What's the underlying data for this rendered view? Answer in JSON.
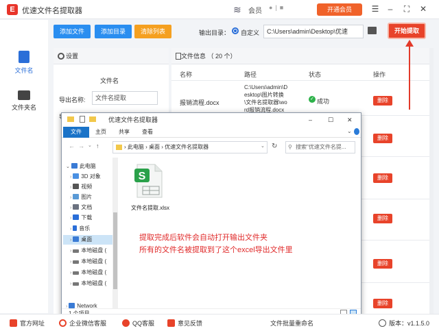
{
  "app": {
    "title": "优速文件名提取器",
    "logo_letter": "E",
    "member_text": "会员",
    "vip_button": "开通会员",
    "brand_icon": "brand-s-logo"
  },
  "sidebar": {
    "items": [
      {
        "label": "文件名",
        "icon": "file-icon",
        "color": "#2a6ed8",
        "active": true
      },
      {
        "label": "文件夹名",
        "icon": "folder-icon",
        "color": "#444444",
        "active": false
      }
    ]
  },
  "toolbar": {
    "add_file": "添加文件",
    "add_dir": "添加目录",
    "clear_list": "清除列表",
    "output_label": "输出目录：",
    "custom_label": "自定义",
    "output_path": "C:\\Users\\admin\\Desktop\\优速",
    "start_button": "开始提取"
  },
  "settings": {
    "header": "设置",
    "section_title": "文件名",
    "export_label": "导出名称:",
    "export_value": "文件名提取",
    "second_label": "导"
  },
  "file_list": {
    "header": "文件信息 （ 20 个）",
    "columns": [
      "名称",
      "路径",
      "状态",
      "操作"
    ],
    "rows": [
      {
        "name": "报销流程.docx",
        "path": "C:\\Users\\admin\\Desktop\\图片转换\\文件名提取器\\wo",
        "status": "成功",
        "action": "删除"
      },
      {
        "name": "",
        "path": "",
        "status": "",
        "action": "删除"
      },
      {
        "name": "",
        "path": "",
        "status": "",
        "action": "删除"
      },
      {
        "name": "",
        "path": "",
        "status": "",
        "action": "删除"
      },
      {
        "name": "",
        "path": "",
        "status": "",
        "action": "删除"
      },
      {
        "name": "",
        "path": "",
        "status": "",
        "action": "删除"
      }
    ],
    "row_path_lines": [
      "C:\\Users\\admin\\D",
      "esktop\\图片转换",
      "\\文件名提取器\\wo",
      "rd报销流程.docx"
    ],
    "status_color": "#2db24a"
  },
  "explorer": {
    "title": "优速文件名提取器",
    "ribbon_tabs": [
      "文件",
      "主页",
      "共享",
      "查看"
    ],
    "address": [
      "此电脑",
      "桌面",
      "优速文件名提取器"
    ],
    "search_placeholder": "搜索\"优速文件名提...",
    "tree": [
      {
        "label": "此电脑",
        "icon": "computer-icon",
        "color": "#3a7bd5"
      },
      {
        "label": "3D 对象",
        "icon": "3d-objects-icon",
        "color": "#4a90e2"
      },
      {
        "label": "视频",
        "icon": "video-icon",
        "color": "#555555"
      },
      {
        "label": "图片",
        "icon": "pictures-icon",
        "color": "#5a9ad6"
      },
      {
        "label": "文档",
        "icon": "documents-icon",
        "color": "#6b7280"
      },
      {
        "label": "下载",
        "icon": "download-icon",
        "color": "#2a6ed8"
      },
      {
        "label": "音乐",
        "icon": "music-icon",
        "color": "#2a6ed8"
      },
      {
        "label": "桌面",
        "icon": "desktop-icon",
        "color": "#3a7bd5"
      },
      {
        "label": "本地磁盘 (",
        "icon": "disk-icon",
        "color": "#777777"
      },
      {
        "label": "本地磁盘 (",
        "icon": "disk-icon",
        "color": "#777777"
      },
      {
        "label": "本地磁盘 (",
        "icon": "disk-icon",
        "color": "#777777"
      },
      {
        "label": "本地磁盘 (",
        "icon": "disk-icon",
        "color": "#777777"
      },
      {
        "label": "Network",
        "icon": "network-icon",
        "color": "#3a7bd5"
      }
    ],
    "selected_tree_index": 7,
    "file": {
      "name": "文件名提取.xlsx",
      "badge": "S",
      "badge_color": "#2aa14a"
    },
    "status": "1 个项目"
  },
  "annotation": {
    "line1": "提取完成后软件会自动打开输出文件夹",
    "line2": "所有的文件名被提取到了这个excel导出文件里",
    "color": "#e02a2a"
  },
  "bottom": {
    "items": [
      {
        "label": "官方网址",
        "icon": "home-icon",
        "color": "#e8432a"
      },
      {
        "label": "企业微信客服",
        "icon": "wechat-icon",
        "color": "#e8432a"
      },
      {
        "label": "QQ客服",
        "icon": "qq-icon",
        "color": "#e8432a"
      },
      {
        "label": "意见反馈",
        "icon": "feedback-icon",
        "color": "#e8432a"
      }
    ],
    "center": "文件批量重命名",
    "version": "版本：v1.1.5.0"
  },
  "colors": {
    "accent_blue": "#2a8ef0",
    "accent_orange": "#f5a020",
    "accent_red": "#e8432a"
  }
}
